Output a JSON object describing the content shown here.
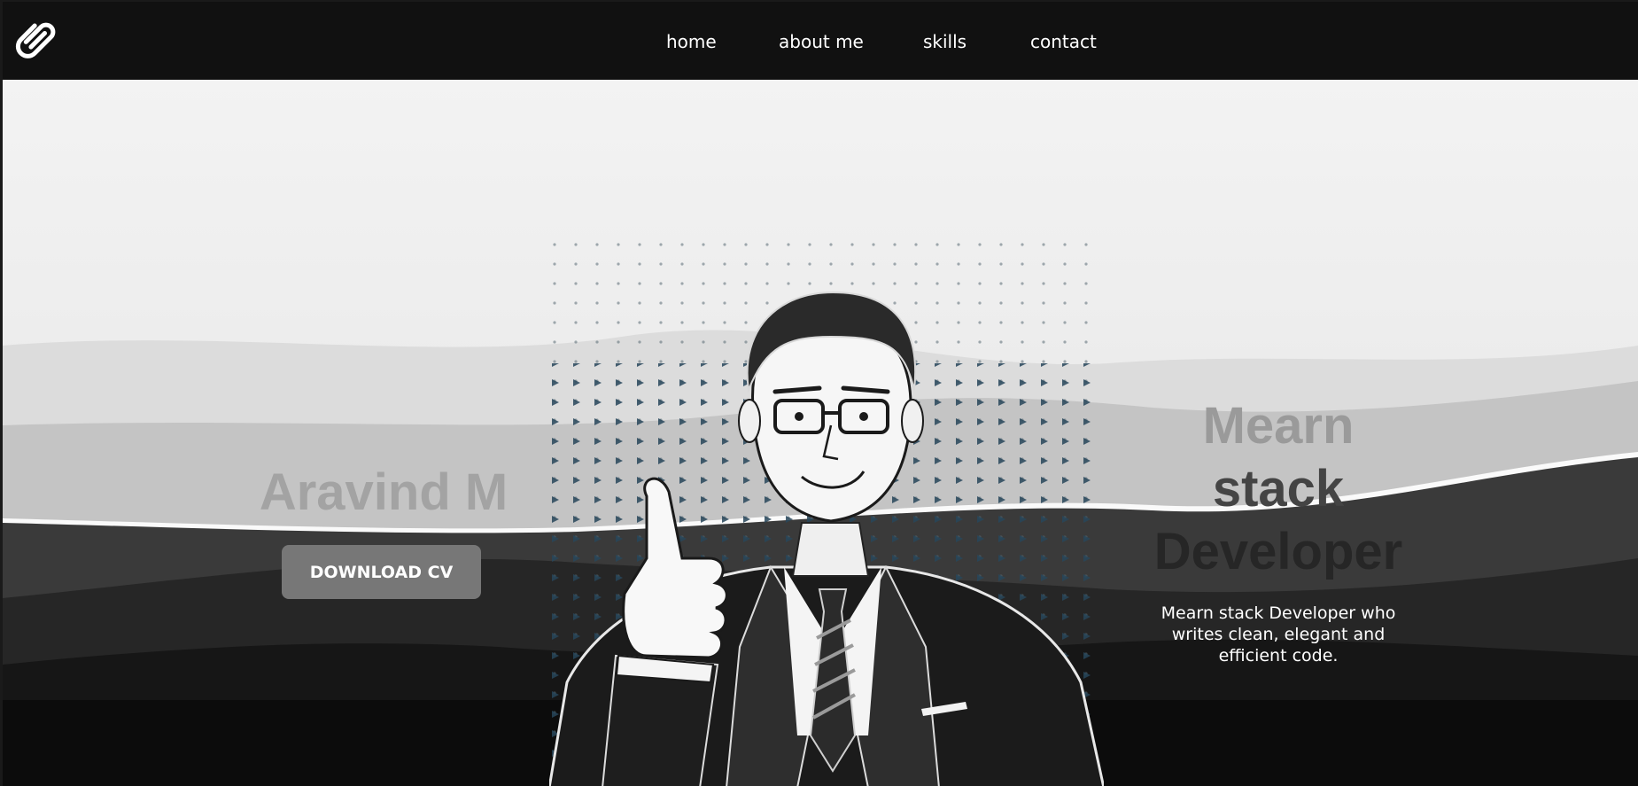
{
  "nav": {
    "logo_icon": "paperclip-icon",
    "items": [
      {
        "label": "home"
      },
      {
        "label": "about me"
      },
      {
        "label": "skills"
      },
      {
        "label": "contact"
      }
    ]
  },
  "hero": {
    "name": "Aravind M",
    "download_label": "DOWNLOAD CV",
    "role_lines": [
      "Mearn",
      "stack",
      "Developer"
    ],
    "tagline": "Mearn stack Developer who writes clean, elegant and efficient code."
  },
  "colors": {
    "navbar": "#111111",
    "hero_bg": "#f1f1f1",
    "button": "#777777",
    "name_text": "#a3a3a3"
  }
}
